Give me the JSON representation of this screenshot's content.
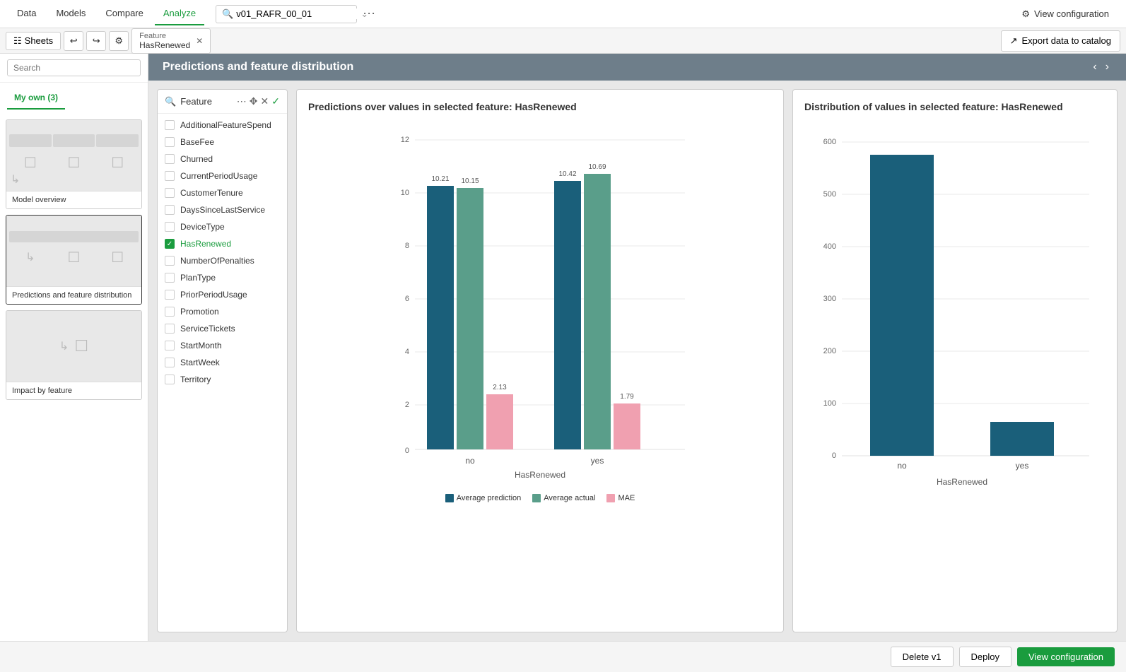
{
  "topnav": {
    "items": [
      "Data",
      "Models",
      "Compare",
      "Analyze"
    ],
    "active": "Analyze",
    "search_value": "v01_RAFR_00_01",
    "view_config_label": "View configuration"
  },
  "sheetrow": {
    "sheets_label": "Sheets",
    "export_label": "Export data to catalog",
    "active_tab": {
      "title": "Feature",
      "name": "HasRenewed"
    }
  },
  "sidebar": {
    "search_placeholder": "Search",
    "section_label": "My own (3)",
    "cards": [
      {
        "label": "Model overview"
      },
      {
        "label": "Predictions and feature distribution"
      },
      {
        "label": "Impact by feature"
      }
    ]
  },
  "content_header": {
    "title": "Predictions and feature distribution"
  },
  "feature_panel": {
    "label": "Feature",
    "features": [
      {
        "name": "AdditionalFeatureSpend",
        "checked": false
      },
      {
        "name": "BaseFee",
        "checked": false
      },
      {
        "name": "Churned",
        "checked": false
      },
      {
        "name": "CurrentPeriodUsage",
        "checked": false
      },
      {
        "name": "CustomerTenure",
        "checked": false
      },
      {
        "name": "DaysSinceLastService",
        "checked": false
      },
      {
        "name": "DeviceType",
        "checked": false
      },
      {
        "name": "HasRenewed",
        "checked": true
      },
      {
        "name": "NumberOfPenalties",
        "checked": false
      },
      {
        "name": "PlanType",
        "checked": false
      },
      {
        "name": "PriorPeriodUsage",
        "checked": false
      },
      {
        "name": "Promotion",
        "checked": false
      },
      {
        "name": "ServiceTickets",
        "checked": false
      },
      {
        "name": "StartMonth",
        "checked": false
      },
      {
        "name": "StartWeek",
        "checked": false
      },
      {
        "name": "Territory",
        "checked": false
      }
    ]
  },
  "predictions_chart": {
    "title": "Predictions over values in selected feature: HasRenewed",
    "x_label": "HasRenewed",
    "x_categories": [
      "no",
      "yes"
    ],
    "y_max": 12,
    "y_min": 0,
    "y_ticks": [
      0,
      2,
      4,
      6,
      8,
      10,
      12
    ],
    "bars": {
      "no": {
        "avg_prediction": {
          "value": 10.21,
          "color": "#1a5f7a"
        },
        "avg_actual": {
          "value": 10.15,
          "color": "#5a9e8a"
        },
        "mae": {
          "value": 2.13,
          "color": "#f0a0b0"
        }
      },
      "yes": {
        "avg_prediction": {
          "value": 10.42,
          "color": "#1a5f7a"
        },
        "avg_actual": {
          "value": 10.69,
          "color": "#5a9e8a"
        },
        "mae": {
          "value": 1.79,
          "color": "#f0a0b0"
        }
      }
    },
    "legend": [
      {
        "label": "Average prediction",
        "color": "#1a5f7a"
      },
      {
        "label": "Average actual",
        "color": "#5a9e8a"
      },
      {
        "label": "MAE",
        "color": "#f0a0b0"
      }
    ]
  },
  "distribution_chart": {
    "title": "Distribution of values in selected feature: HasRenewed",
    "x_label": "HasRenewed",
    "x_categories": [
      "no",
      "yes"
    ],
    "y_max": 600,
    "y_ticks": [
      0,
      100,
      200,
      300,
      400,
      500,
      600
    ],
    "bars": {
      "no": {
        "value": 575,
        "color": "#1a5f7a"
      },
      "yes": {
        "value": 65,
        "color": "#1a5f7a"
      }
    }
  },
  "bottom_bar": {
    "delete_label": "Delete v1",
    "deploy_label": "Deploy",
    "view_config_label": "View configuration"
  }
}
